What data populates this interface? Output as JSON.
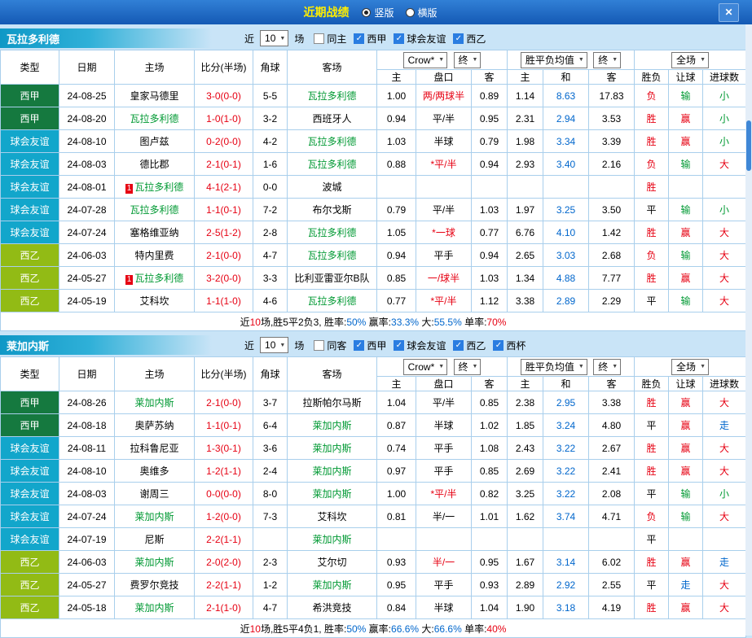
{
  "header": {
    "title": "近期战绩",
    "layout_options": [
      {
        "label": "竖版",
        "selected": true
      },
      {
        "label": "横版",
        "selected": false
      }
    ],
    "close_icon": "✕"
  },
  "table_header": {
    "type": "类型",
    "date": "日期",
    "home": "主场",
    "score": "比分(半场)",
    "corners": "角球",
    "away": "客场",
    "odds_home": "主",
    "odds_hcp": "盘口",
    "odds_away": "客",
    "avg_home": "主",
    "avg_draw": "和",
    "avg_away": "客",
    "result": "胜负",
    "handicap_result": "让球",
    "goals": "进球数",
    "bookmaker": "Crow*",
    "stage": "终",
    "avg": "胜平负均值",
    "stage2": "终",
    "scope": "全场"
  },
  "colors": {
    "accent_red": "#e60012",
    "focal_green": "#009933",
    "value_blue": "#0066cc",
    "liga_green": "#15793f",
    "friendly_teal": "#12a6cb",
    "segunda_lime": "#92bb15"
  },
  "sections": [
    {
      "team": "瓦拉多利德",
      "near_label": "近",
      "count": "10",
      "games_label": "场",
      "filters": [
        {
          "label": "同主",
          "checked": false
        },
        {
          "label": "西甲",
          "checked": true
        },
        {
          "label": "球会友谊",
          "checked": true
        },
        {
          "label": "西乙",
          "checked": true
        }
      ],
      "rows": [
        {
          "type": "西甲",
          "date": "24-08-25",
          "home": "皇家马德里",
          "homeFocal": false,
          "badge": "",
          "score": "3-0(0-0)",
          "corners": "5-5",
          "away": "瓦拉多利德",
          "awayFocal": true,
          "oh": "1.00",
          "hcp": "两/两球半",
          "hcpRed": true,
          "oa": "0.89",
          "ah": "1.14",
          "ad": "8.63",
          "aa": "17.83",
          "res": "负",
          "resC": "r",
          "let": "输",
          "letC": "g",
          "goal": "小",
          "goalC": "g"
        },
        {
          "type": "西甲",
          "date": "24-08-20",
          "home": "瓦拉多利德",
          "homeFocal": true,
          "badge": "",
          "score": "1-0(1-0)",
          "corners": "3-2",
          "away": "西班牙人",
          "awayFocal": false,
          "oh": "0.94",
          "hcp": "平/半",
          "hcpRed": false,
          "oa": "0.95",
          "ah": "2.31",
          "ad": "2.94",
          "aa": "3.53",
          "res": "胜",
          "resC": "r",
          "let": "赢",
          "letC": "r",
          "goal": "小",
          "goalC": "g"
        },
        {
          "type": "球会友谊",
          "date": "24-08-10",
          "home": "图卢兹",
          "homeFocal": false,
          "badge": "",
          "score": "0-2(0-0)",
          "corners": "4-2",
          "away": "瓦拉多利德",
          "awayFocal": true,
          "oh": "1.03",
          "hcp": "半球",
          "hcpRed": false,
          "oa": "0.79",
          "ah": "1.98",
          "ad": "3.34",
          "aa": "3.39",
          "res": "胜",
          "resC": "r",
          "let": "赢",
          "letC": "r",
          "goal": "小",
          "goalC": "g"
        },
        {
          "type": "球会友谊",
          "date": "24-08-03",
          "home": "德比郡",
          "homeFocal": false,
          "badge": "",
          "score": "2-1(0-1)",
          "corners": "1-6",
          "away": "瓦拉多利德",
          "awayFocal": true,
          "oh": "0.88",
          "hcp": "*平/半",
          "hcpRed": true,
          "oa": "0.94",
          "ah": "2.93",
          "ad": "3.40",
          "aa": "2.16",
          "res": "负",
          "resC": "r",
          "let": "输",
          "letC": "g",
          "goal": "大",
          "goalC": "r"
        },
        {
          "type": "球会友谊",
          "date": "24-08-01",
          "home": "瓦拉多利德",
          "homeFocal": true,
          "badge": "1",
          "score": "4-1(2-1)",
          "corners": "0-0",
          "away": "波城",
          "awayFocal": false,
          "oh": "",
          "hcp": "",
          "hcpRed": false,
          "oa": "",
          "ah": "",
          "ad": "",
          "aa": "",
          "res": "胜",
          "resC": "r",
          "let": "",
          "letC": "k",
          "goal": "",
          "goalC": "k"
        },
        {
          "type": "球会友谊",
          "date": "24-07-28",
          "home": "瓦拉多利德",
          "homeFocal": true,
          "badge": "",
          "score": "1-1(0-1)",
          "corners": "7-2",
          "away": "布尔戈斯",
          "awayFocal": false,
          "oh": "0.79",
          "hcp": "平/半",
          "hcpRed": false,
          "oa": "1.03",
          "ah": "1.97",
          "ad": "3.25",
          "aa": "3.50",
          "res": "平",
          "resC": "k",
          "let": "输",
          "letC": "g",
          "goal": "小",
          "goalC": "g"
        },
        {
          "type": "球会友谊",
          "date": "24-07-24",
          "home": "塞格维亚纳",
          "homeFocal": false,
          "badge": "",
          "score": "2-5(1-2)",
          "corners": "2-8",
          "away": "瓦拉多利德",
          "awayFocal": true,
          "oh": "1.05",
          "hcp": "*一球",
          "hcpRed": true,
          "oa": "0.77",
          "ah": "6.76",
          "ad": "4.10",
          "aa": "1.42",
          "res": "胜",
          "resC": "r",
          "let": "赢",
          "letC": "r",
          "goal": "大",
          "goalC": "r"
        },
        {
          "type": "西乙",
          "date": "24-06-03",
          "home": "特内里费",
          "homeFocal": false,
          "badge": "",
          "score": "2-1(0-0)",
          "corners": "4-7",
          "away": "瓦拉多利德",
          "awayFocal": true,
          "oh": "0.94",
          "hcp": "平手",
          "hcpRed": false,
          "oa": "0.94",
          "ah": "2.65",
          "ad": "3.03",
          "aa": "2.68",
          "res": "负",
          "resC": "r",
          "let": "输",
          "letC": "g",
          "goal": "大",
          "goalC": "r"
        },
        {
          "type": "西乙",
          "date": "24-05-27",
          "home": "瓦拉多利德",
          "homeFocal": true,
          "badge": "1",
          "score": "3-2(0-0)",
          "corners": "3-3",
          "away": "比利亚雷亚尔B队",
          "awayFocal": false,
          "oh": "0.85",
          "hcp": "一/球半",
          "hcpRed": true,
          "oa": "1.03",
          "ah": "1.34",
          "ad": "4.88",
          "aa": "7.77",
          "res": "胜",
          "resC": "r",
          "let": "赢",
          "letC": "r",
          "goal": "大",
          "goalC": "r"
        },
        {
          "type": "西乙",
          "date": "24-05-19",
          "home": "艾科坎",
          "homeFocal": false,
          "badge": "",
          "score": "1-1(1-0)",
          "corners": "4-6",
          "away": "瓦拉多利德",
          "awayFocal": true,
          "oh": "0.77",
          "hcp": "*平/半",
          "hcpRed": true,
          "oa": "1.12",
          "ah": "3.38",
          "ad": "2.89",
          "aa": "2.29",
          "res": "平",
          "resC": "k",
          "let": "输",
          "letC": "g",
          "goal": "大",
          "goalC": "r"
        }
      ],
      "summary": [
        {
          "t": "近",
          "c": "k"
        },
        {
          "t": "10",
          "c": "r"
        },
        {
          "t": "场,胜5平2负3, 胜率:",
          "c": "k"
        },
        {
          "t": "50%",
          "c": "b"
        },
        {
          "t": " 赢率:",
          "c": "k"
        },
        {
          "t": "33.3%",
          "c": "b"
        },
        {
          "t": " 大:",
          "c": "k"
        },
        {
          "t": "55.5%",
          "c": "b"
        },
        {
          "t": " 单率:",
          "c": "k"
        },
        {
          "t": "70%",
          "c": "r"
        }
      ]
    },
    {
      "team": "莱加内斯",
      "near_label": "近",
      "count": "10",
      "games_label": "场",
      "filters": [
        {
          "label": "同客",
          "checked": false
        },
        {
          "label": "西甲",
          "checked": true
        },
        {
          "label": "球会友谊",
          "checked": true
        },
        {
          "label": "西乙",
          "checked": true
        },
        {
          "label": "西杯",
          "checked": true
        }
      ],
      "rows": [
        {
          "type": "西甲",
          "date": "24-08-26",
          "home": "莱加内斯",
          "homeFocal": true,
          "badge": "",
          "score": "2-1(0-0)",
          "corners": "3-7",
          "away": "拉斯帕尔马斯",
          "awayFocal": false,
          "oh": "1.04",
          "hcp": "平/半",
          "hcpRed": false,
          "oa": "0.85",
          "ah": "2.38",
          "ad": "2.95",
          "aa": "3.38",
          "res": "胜",
          "resC": "r",
          "let": "赢",
          "letC": "r",
          "goal": "大",
          "goalC": "r"
        },
        {
          "type": "西甲",
          "date": "24-08-18",
          "home": "奥萨苏纳",
          "homeFocal": false,
          "badge": "",
          "score": "1-1(0-1)",
          "corners": "6-4",
          "away": "莱加内斯",
          "awayFocal": true,
          "oh": "0.87",
          "hcp": "半球",
          "hcpRed": false,
          "oa": "1.02",
          "ah": "1.85",
          "ad": "3.24",
          "aa": "4.80",
          "res": "平",
          "resC": "k",
          "let": "赢",
          "letC": "r",
          "goal": "走",
          "goalC": "b"
        },
        {
          "type": "球会友谊",
          "date": "24-08-11",
          "home": "拉科鲁尼亚",
          "homeFocal": false,
          "badge": "",
          "score": "1-3(0-1)",
          "corners": "3-6",
          "away": "莱加内斯",
          "awayFocal": true,
          "oh": "0.74",
          "hcp": "平手",
          "hcpRed": false,
          "oa": "1.08",
          "ah": "2.43",
          "ad": "3.22",
          "aa": "2.67",
          "res": "胜",
          "resC": "r",
          "let": "赢",
          "letC": "r",
          "goal": "大",
          "goalC": "r"
        },
        {
          "type": "球会友谊",
          "date": "24-08-10",
          "home": "奥维多",
          "homeFocal": false,
          "badge": "",
          "score": "1-2(1-1)",
          "corners": "2-4",
          "away": "莱加内斯",
          "awayFocal": true,
          "oh": "0.97",
          "hcp": "平手",
          "hcpRed": false,
          "oa": "0.85",
          "ah": "2.69",
          "ad": "3.22",
          "aa": "2.41",
          "res": "胜",
          "resC": "r",
          "let": "赢",
          "letC": "r",
          "goal": "大",
          "goalC": "r"
        },
        {
          "type": "球会友谊",
          "date": "24-08-03",
          "home": "谢周三",
          "homeFocal": false,
          "badge": "",
          "score": "0-0(0-0)",
          "corners": "8-0",
          "away": "莱加内斯",
          "awayFocal": true,
          "oh": "1.00",
          "hcp": "*平/半",
          "hcpRed": true,
          "oa": "0.82",
          "ah": "3.25",
          "ad": "3.22",
          "aa": "2.08",
          "res": "平",
          "resC": "k",
          "let": "输",
          "letC": "g",
          "goal": "小",
          "goalC": "g"
        },
        {
          "type": "球会友谊",
          "date": "24-07-24",
          "home": "莱加内斯",
          "homeFocal": true,
          "badge": "",
          "score": "1-2(0-0)",
          "corners": "7-3",
          "away": "艾科坎",
          "awayFocal": false,
          "oh": "0.81",
          "hcp": "半/一",
          "hcpRed": false,
          "oa": "1.01",
          "ah": "1.62",
          "ad": "3.74",
          "aa": "4.71",
          "res": "负",
          "resC": "r",
          "let": "输",
          "letC": "g",
          "goal": "大",
          "goalC": "r"
        },
        {
          "type": "球会友谊",
          "date": "24-07-19",
          "home": "尼斯",
          "homeFocal": false,
          "badge": "",
          "score": "2-2(1-1)",
          "corners": "",
          "away": "莱加内斯",
          "awayFocal": true,
          "oh": "",
          "hcp": "",
          "hcpRed": false,
          "oa": "",
          "ah": "",
          "ad": "",
          "aa": "",
          "res": "平",
          "resC": "k",
          "let": "",
          "letC": "k",
          "goal": "",
          "goalC": "k"
        },
        {
          "type": "西乙",
          "date": "24-06-03",
          "home": "莱加内斯",
          "homeFocal": true,
          "badge": "",
          "score": "2-0(2-0)",
          "corners": "2-3",
          "away": "艾尔切",
          "awayFocal": false,
          "oh": "0.93",
          "hcp": "半/一",
          "hcpRed": true,
          "oa": "0.95",
          "ah": "1.67",
          "ad": "3.14",
          "aa": "6.02",
          "res": "胜",
          "resC": "r",
          "let": "赢",
          "letC": "r",
          "goal": "走",
          "goalC": "b"
        },
        {
          "type": "西乙",
          "date": "24-05-27",
          "home": "费罗尔竞技",
          "homeFocal": false,
          "badge": "",
          "score": "2-2(1-1)",
          "corners": "1-2",
          "away": "莱加内斯",
          "awayFocal": true,
          "oh": "0.95",
          "hcp": "平手",
          "hcpRed": false,
          "oa": "0.93",
          "ah": "2.89",
          "ad": "2.92",
          "aa": "2.55",
          "res": "平",
          "resC": "k",
          "let": "走",
          "letC": "b",
          "goal": "大",
          "goalC": "r"
        },
        {
          "type": "西乙",
          "date": "24-05-18",
          "home": "莱加内斯",
          "homeFocal": true,
          "badge": "",
          "score": "2-1(1-0)",
          "corners": "4-7",
          "away": "希洪竞技",
          "awayFocal": false,
          "oh": "0.84",
          "hcp": "半球",
          "hcpRed": false,
          "oa": "1.04",
          "ah": "1.90",
          "ad": "3.18",
          "aa": "4.19",
          "res": "胜",
          "resC": "r",
          "let": "赢",
          "letC": "r",
          "goal": "大",
          "goalC": "r"
        }
      ],
      "summary": [
        {
          "t": "近",
          "c": "k"
        },
        {
          "t": "10",
          "c": "r"
        },
        {
          "t": "场,胜5平4负1, 胜率:",
          "c": "k"
        },
        {
          "t": "50%",
          "c": "b"
        },
        {
          "t": " 赢率:",
          "c": "k"
        },
        {
          "t": "66.6%",
          "c": "b"
        },
        {
          "t": " 大:",
          "c": "k"
        },
        {
          "t": "66.6%",
          "c": "b"
        },
        {
          "t": " 单率:",
          "c": "k"
        },
        {
          "t": "40%",
          "c": "r"
        }
      ]
    }
  ]
}
